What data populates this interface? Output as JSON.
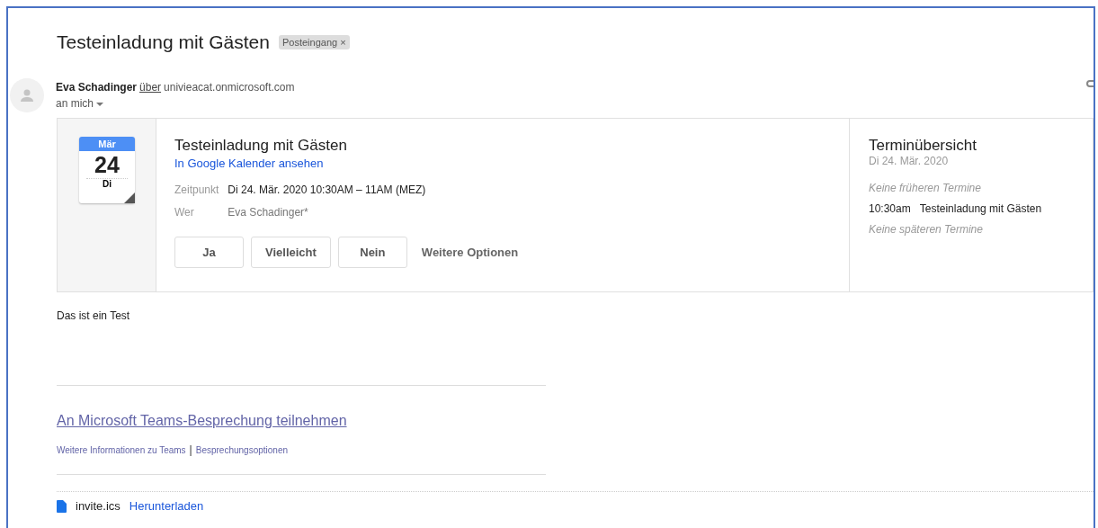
{
  "subject": "Testeinladung mit Gästen",
  "label": {
    "text": "Posteingang",
    "close": "×"
  },
  "sender": {
    "name": "Eva Schadinger",
    "via": "über",
    "domain": "univieacat.onmicrosoft.com",
    "to": "an mich"
  },
  "invite": {
    "month": "Mär",
    "day": "24",
    "weekday": "Di",
    "title": "Testeinladung mit Gästen",
    "calendar_link": "In Google Kalender ansehen",
    "details": [
      {
        "label": "Zeitpunkt",
        "value": "Di 24. Mär. 2020 10:30AM – 11AM (MEZ)",
        "kind": "dark"
      },
      {
        "label": "Wer",
        "value": "Eva Schadinger*",
        "kind": "muted"
      }
    ],
    "buttons": [
      "Ja",
      "Vielleicht",
      "Nein"
    ],
    "more_options": "Weitere Optionen"
  },
  "agenda": {
    "title": "Terminübersicht",
    "date": "Di 24. Mär. 2020",
    "items": [
      {
        "kind": "note",
        "text": "Keine früheren Termine"
      },
      {
        "kind": "event",
        "time": "10:30am",
        "text": "Testeinladung mit Gästen"
      },
      {
        "kind": "note",
        "text": "Keine späteren Termine"
      }
    ]
  },
  "body": "Das ist ein Test",
  "teams": {
    "join": "An Microsoft Teams-Besprechung teilnehmen",
    "links": [
      "Weitere Informationen zu Teams",
      "Besprechungsoptionen"
    ],
    "separator": "|"
  },
  "attachment": {
    "name": "invite.ics",
    "action": "Herunterladen"
  }
}
